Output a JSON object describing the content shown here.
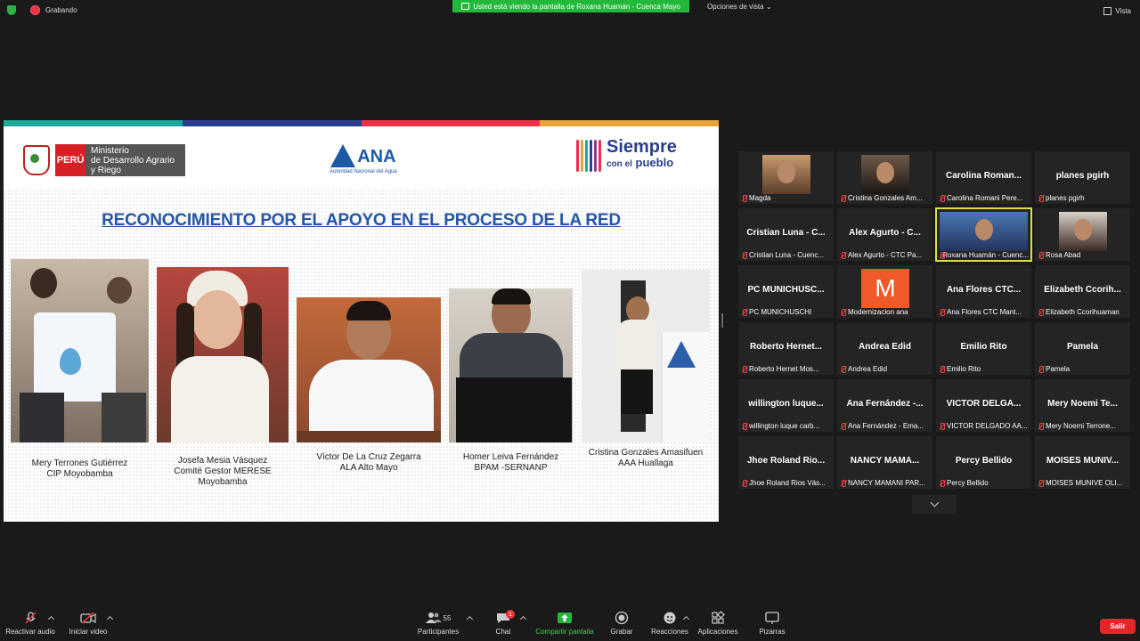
{
  "top": {
    "recording": "Grabando",
    "viewing_banner": "Usted está viendo la pantalla de Roxana Huamán - Cuenca Mayo",
    "view_options": "Opciones de vista",
    "view": "Vista"
  },
  "slide": {
    "stripe_colors": [
      "#1fa79a",
      "#2b3f8f",
      "#e9334a",
      "#e8a33a"
    ],
    "peru_tag": "PERÚ",
    "ministry": [
      "Ministerio",
      "de Desarrollo Agrario",
      "y Riego"
    ],
    "ana_name": "ANA",
    "ana_sub": "Autoridad Nacional del Agua",
    "slogan_1": "Siempre",
    "slogan_2a": "con el",
    "slogan_2b": "pueblo",
    "title": "RECONOCIMIENTO POR EL APOYO EN EL PROCESO DE LA RED",
    "people": [
      {
        "lines": [
          "Mery Terrones Gutiérrez",
          "CIP Moyobamba"
        ]
      },
      {
        "lines": [
          "Josefa Mesia Vásquez",
          "Comité Gestor MERESE",
          "Moyobamba"
        ]
      },
      {
        "lines": [
          "Víctor De La Cruz Zegarra",
          "ALA Alto Mayo"
        ]
      },
      {
        "lines": [
          "Homer Leiva Fernández",
          "BPAM -SERNANP"
        ]
      },
      {
        "lines": [
          "Cristina Gonzales Amasifuen",
          "AAA Huallaga"
        ]
      }
    ]
  },
  "gallery": [
    {
      "big": "",
      "label": "Magda",
      "face": "photo"
    },
    {
      "big": "",
      "label": "Cristina Gonzales Am...",
      "face": "photo"
    },
    {
      "big": "Carolina  Roman...",
      "label": "Carolina Romani Pere..."
    },
    {
      "big": "planes pgirh",
      "label": "planes pgirh"
    },
    {
      "big": "Cristian Luna - C...",
      "label": "Cristian Luna - Cuenc..."
    },
    {
      "big": "Alex Agurto - C...",
      "label": "Alex Agurto - CTC Pa..."
    },
    {
      "big": "",
      "label": "Roxana Huamán - Cuenc...",
      "face": "photo",
      "active": true
    },
    {
      "big": "",
      "label": "Rosa Abad",
      "face": "photo"
    },
    {
      "big": "PC  MUNICHUSC...",
      "label": "PC MUNICHUSCHI"
    },
    {
      "big": "M",
      "label": "Modernizacion ana",
      "face": "m"
    },
    {
      "big": "Ana Flores CTC...",
      "label": "Ana Flores CTC Mant..."
    },
    {
      "big": "Elizabeth  Ccorih...",
      "label": "Elizabeth Ccorihuaman"
    },
    {
      "big": "Roberto  Hernet...",
      "label": "Roberto Hernet Mos..."
    },
    {
      "big": "Andrea Edid",
      "label": "Andrea Edid"
    },
    {
      "big": "Emilio Rito",
      "label": "Emilio Rito"
    },
    {
      "big": "Pamela",
      "label": "Pamela"
    },
    {
      "big": "willington  luque...",
      "label": "willington luque carb..."
    },
    {
      "big": "Ana Fernández -...",
      "label": "Ana Fernández - Ema..."
    },
    {
      "big": "VICTOR  DELGA...",
      "label": "VICTOR DELGADO AA..."
    },
    {
      "big": "Mery  Noemi  Te...",
      "label": "Mery Noemi Terrone..."
    },
    {
      "big": "Jhoe Roland Rio...",
      "label": "Jhoe Roland Rios Vás..."
    },
    {
      "big": "NANCY  MAMA...",
      "label": "NANCY MAMANI PAR..."
    },
    {
      "big": "Percy Bellido",
      "label": "Percy Bellido"
    },
    {
      "big": "MOISES  MUNIV...",
      "label": "MOISES MUNIVE OLI..."
    }
  ],
  "toolbar": {
    "unmute": "Reactivar audio",
    "start_video": "Iniciar video",
    "participants": "Participantes",
    "participants_count": "55",
    "chat": "Chat",
    "chat_badge": "1",
    "share": "Compartir pantalla",
    "record": "Grabar",
    "reactions": "Reacciones",
    "apps": "Aplicaciones",
    "whiteboards": "Pizarras",
    "leave": "Salir"
  }
}
